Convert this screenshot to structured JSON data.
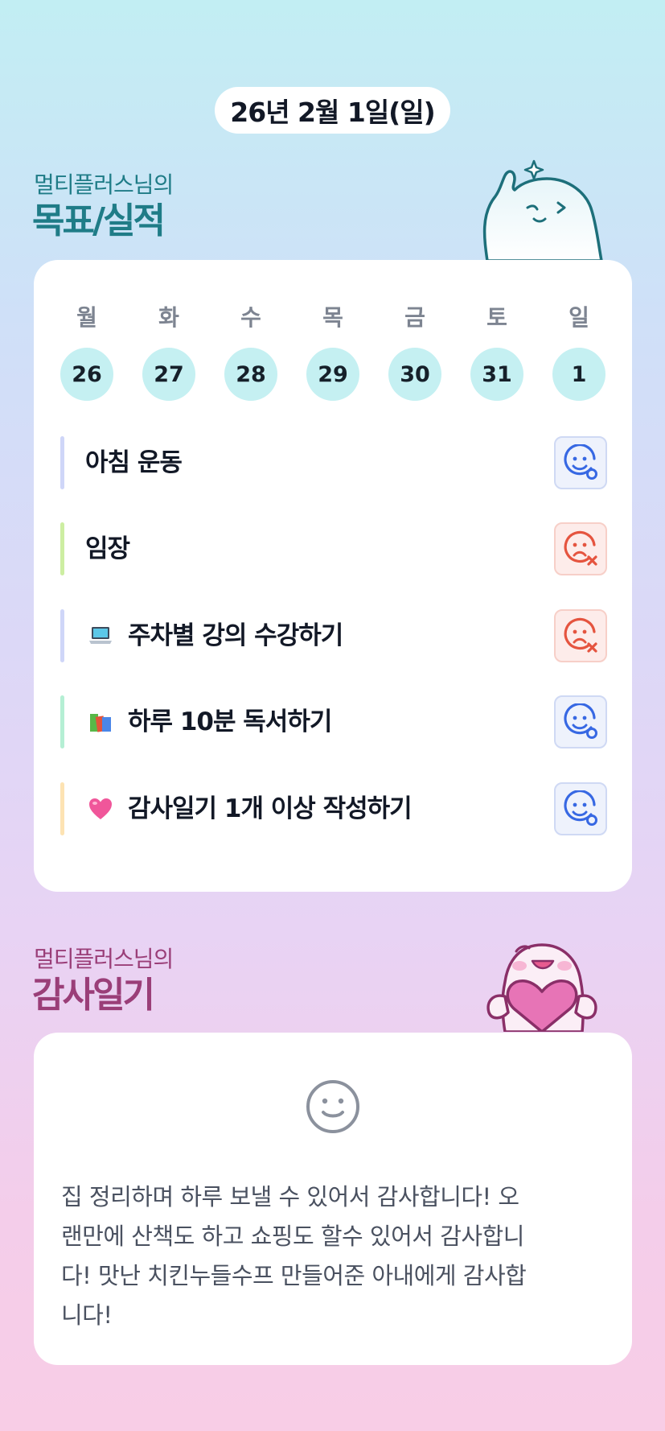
{
  "date_label": "26년 2월 1일(일)",
  "goals_section": {
    "subtitle": "멀티플러스님의",
    "title": "목표/실적"
  },
  "week": {
    "days": [
      {
        "name": "월",
        "num": "26"
      },
      {
        "name": "화",
        "num": "27"
      },
      {
        "name": "수",
        "num": "28"
      },
      {
        "name": "목",
        "num": "29"
      },
      {
        "name": "금",
        "num": "30"
      },
      {
        "name": "토",
        "num": "31"
      },
      {
        "name": "일",
        "num": "1"
      }
    ]
  },
  "goals": [
    {
      "label": "아침 운동",
      "emoji": "",
      "status": "achieved",
      "bar_color": "#cfd6f8"
    },
    {
      "label": "임장",
      "emoji": "",
      "status": "failed",
      "bar_color": "#cdeea2"
    },
    {
      "label": "주차별 강의 수강하기",
      "emoji": "laptop-icon",
      "status": "failed",
      "bar_color": "#cfd6f8"
    },
    {
      "label": "하루 10분 독서하기",
      "emoji": "books-icon",
      "status": "achieved",
      "bar_color": "#b5efd4"
    },
    {
      "label": "감사일기 1개 이상 작성하기",
      "emoji": "heart-icon",
      "status": "achieved",
      "bar_color": "#fde3b3"
    }
  ],
  "gratitude_section": {
    "subtitle": "멀티플러스님의",
    "title": "감사일기"
  },
  "gratitude": {
    "mood_icon": "smile-icon",
    "lines": [
      "집 정리하며 하루 보낼 수 있어서 감사합니다! 오",
      "랜만에 산책도 하고 쇼핑도 할수 있어서 감사합니",
      "다! 맛난 치킨누들수프 만들어준 아내에게 감사합",
      "니다!"
    ]
  },
  "colors": {
    "accent_teal": "#1f7c87",
    "accent_plum": "#9a3e78",
    "day_circle": "#c5f0f2",
    "achieved_blue": "#3768e3",
    "failed_red": "#e5543f"
  }
}
